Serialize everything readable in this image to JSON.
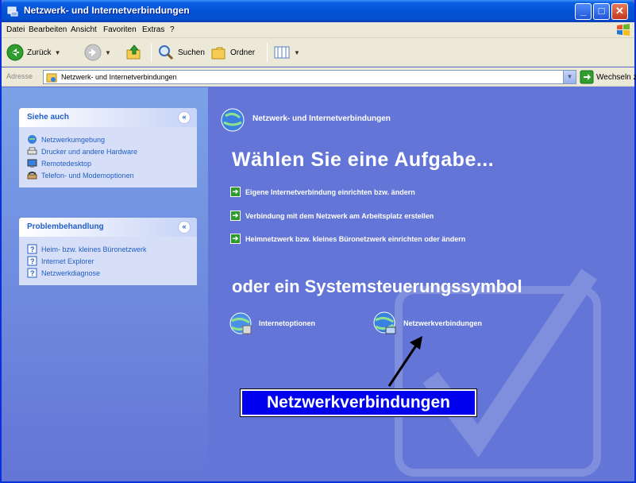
{
  "window": {
    "title": "Netzwerk- und Internetverbindungen"
  },
  "menu": {
    "items": [
      "Datei",
      "Bearbeiten",
      "Ansicht",
      "Favoriten",
      "Extras",
      "?"
    ]
  },
  "toolbar": {
    "back_label": "Zurück",
    "search_label": "Suchen",
    "folders_label": "Ordner"
  },
  "address": {
    "label": "Adresse",
    "value": "Netzwerk- und Internetverbindungen",
    "go_label": "Wechseln zu"
  },
  "see_also": {
    "title": "Siehe auch",
    "items": [
      {
        "label": "Netzwerkumgebung",
        "icon": "network-neighborhood-icon"
      },
      {
        "label": "Drucker und andere Hardware",
        "icon": "printer-icon"
      },
      {
        "label": "Remotedesktop",
        "icon": "remote-desktop-icon"
      },
      {
        "label": "Telefon- und Modemoptionen",
        "icon": "phone-modem-icon"
      }
    ]
  },
  "troubleshoot": {
    "title": "Problembehandlung",
    "items": [
      {
        "label": "Heim- bzw. kleines Büronetzwerk",
        "icon": "help-icon"
      },
      {
        "label": "Internet Explorer",
        "icon": "help-icon"
      },
      {
        "label": "Netzwerkdiagnose",
        "icon": "help-icon"
      }
    ]
  },
  "main": {
    "category_title": "Netzwerk- und Internetverbindungen",
    "task_heading": "Wählen Sie eine Aufgabe...",
    "tasks": [
      "Eigene Internetverbindung einrichten bzw. ändern",
      "Verbindung mit dem Netzwerk am Arbeitsplatz erstellen",
      "Heimnetzwerk bzw. kleines Büronetzwerk einrichten oder ändern"
    ],
    "panel_heading": "oder ein Systemsteuerungssymbol",
    "panel_icons": [
      {
        "label": "Internetoptionen",
        "icon": "internet-options-icon"
      },
      {
        "label": "Netzwerkverbindungen",
        "icon": "network-connections-icon"
      }
    ]
  },
  "annotation": {
    "label": "Netzwerkverbindungen"
  },
  "colors": {
    "titlebar": "#0453d4",
    "main_bg": "#6375d6",
    "task_link": "#ffffff",
    "sidebar_link": "#215dc6",
    "annotation_bg": "#0000ee"
  }
}
